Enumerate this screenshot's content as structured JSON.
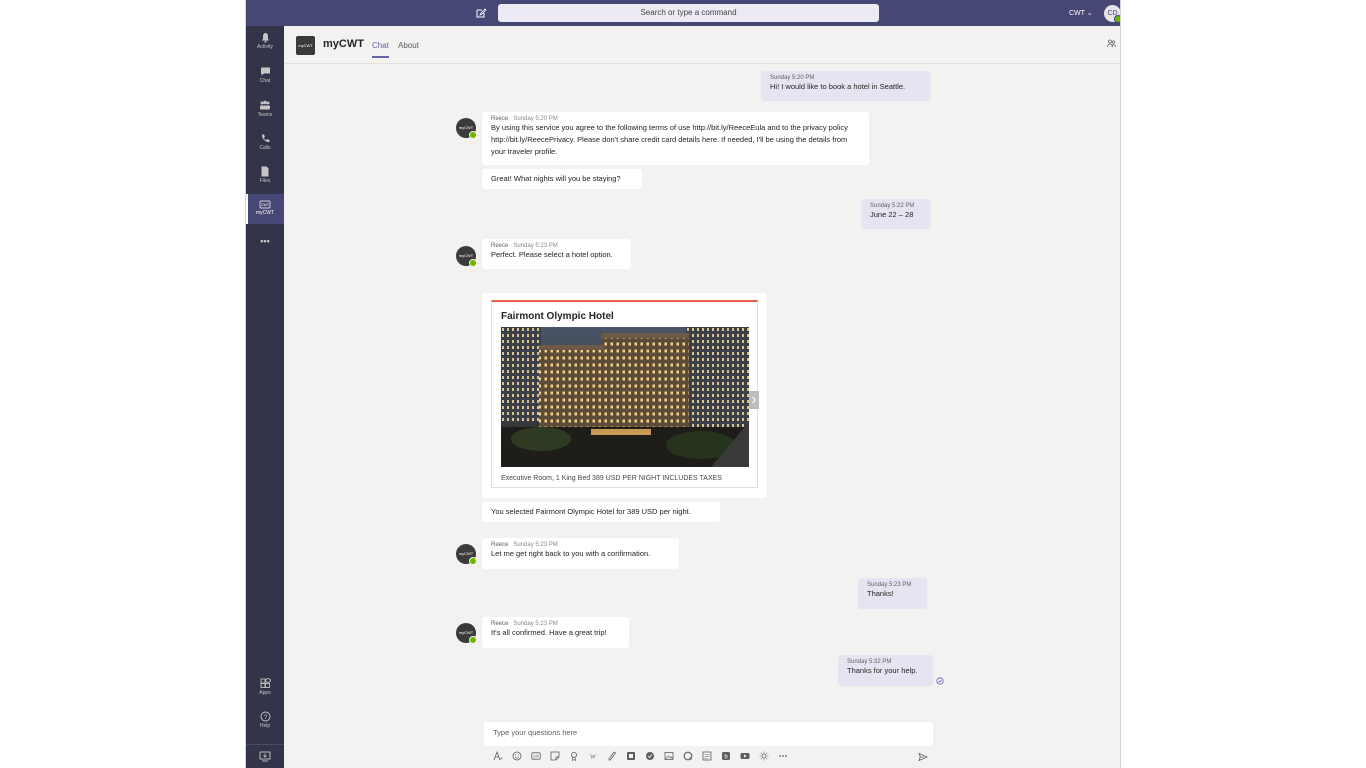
{
  "topbar": {
    "search_placeholder": "Search or type a command",
    "tenant": "CWT ⌄",
    "user_initials": "CD"
  },
  "rail": {
    "items": [
      {
        "label": "Activity",
        "icon": "bell-icon"
      },
      {
        "label": "Chat",
        "icon": "chat-icon"
      },
      {
        "label": "Teams",
        "icon": "teams-icon"
      },
      {
        "label": "Calls",
        "icon": "phone-icon"
      },
      {
        "label": "Files",
        "icon": "file-icon"
      },
      {
        "label": "myCWT",
        "icon": "mycwt-icon"
      },
      {
        "label": "Apps",
        "icon": "apps-icon"
      },
      {
        "label": "Help",
        "icon": "help-icon"
      }
    ],
    "more": "•••"
  },
  "header": {
    "bot_name": "myCWT",
    "tabs": [
      "Chat",
      "About"
    ],
    "logo_text": "myCWT"
  },
  "messages": [
    {
      "from": "me",
      "time": "Sunday 5:20 PM",
      "text": "Hi! I would like to book a hotel in Seattle."
    },
    {
      "from": "bot",
      "sender": "Reece",
      "time": "Sunday 5:20 PM",
      "text": "By using this service you agree to the following terms of use http://bit.ly/ReeceEula and to the privacy policy http://bit.ly/ReecePrivacy. Please don't share credit card details here. If needed, I'll be using the details from your traveler profile."
    },
    {
      "from": "bot",
      "text": "Great! What nights will you be staying?"
    },
    {
      "from": "me",
      "time": "Sunday 5:22 PM",
      "text": "June 22 – 28"
    },
    {
      "from": "bot",
      "sender": "Reece",
      "time": "Sunday 5:23 PM",
      "text": "Perfect. Please select a hotel option."
    },
    {
      "from": "bot",
      "text": "You selected Fairmont Olympic Hotel for 389 USD per night."
    },
    {
      "from": "bot",
      "sender": "Reece",
      "time": "Sunday 5:23 PM",
      "text": "Let me get right back to you with a confirmation."
    },
    {
      "from": "me",
      "time": "Sunday 5:23 PM",
      "text": "Thanks!"
    },
    {
      "from": "bot",
      "sender": "Reece",
      "time": "Sunday 5:23 PM",
      "text": "It's all confirmed. Have a great trip!"
    },
    {
      "from": "me",
      "time": "Sunday 5:32 PM",
      "text": "Thanks for your help."
    }
  ],
  "hotel_card": {
    "title": "Fairmont Olympic Hotel",
    "description": "Executive Room, 1 King Bed 389 USD PER NIGHT INCLUDES TAXES"
  },
  "compose": {
    "placeholder": "Type your questions here"
  }
}
